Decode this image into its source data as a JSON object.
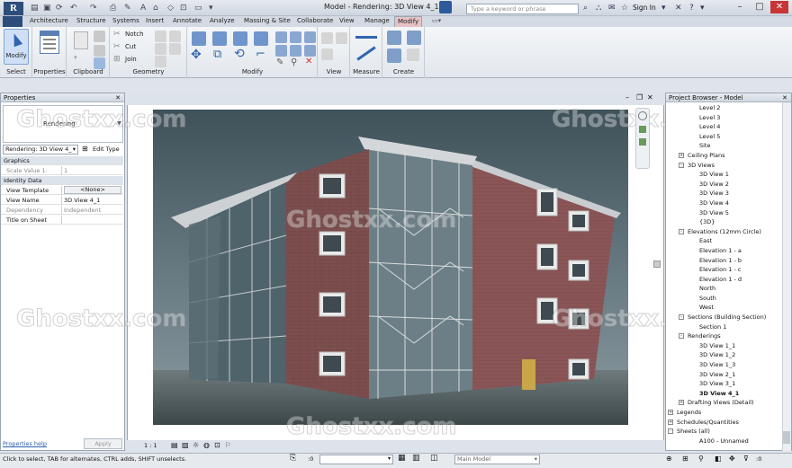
{
  "app": {
    "logo": "R",
    "title": "Model - Rendering: 3D View 4_1",
    "search_placeholder": "Type a keyword or phrase",
    "sign_in": "Sign In"
  },
  "tabs": [
    "Architecture",
    "Structure",
    "Systems",
    "Insert",
    "Annotate",
    "Analyze",
    "Massing & Site",
    "Collaborate",
    "View",
    "Manage",
    "Modify"
  ],
  "active_tab": "Modify",
  "ribbon": {
    "select": {
      "modify": "Modify",
      "label": "Select"
    },
    "properties": "Properties",
    "clipboard": {
      "label": "Clipboard"
    },
    "geometry": {
      "notch": "Notch",
      "cut": "Cut",
      "join": "Join",
      "label": "Geometry"
    },
    "modify_label": "Modify",
    "view_label": "View",
    "measure_label": "Measure",
    "create_label": "Create"
  },
  "properties": {
    "title": "Properties",
    "type_name": "Rendering",
    "view_selector": "Rendering: 3D View 4_",
    "edit_type": "Edit Type",
    "rows": [
      {
        "cat": "Graphics"
      },
      {
        "k": "Scale Value   1:",
        "v": "1",
        "dim": true
      },
      {
        "cat": "Identity Data"
      },
      {
        "k": "View Template",
        "v": "<None>",
        "button": true
      },
      {
        "k": "View Name",
        "v": "3D View 4_1"
      },
      {
        "k": "Dependency",
        "v": "Independent",
        "dim": true
      },
      {
        "k": "Title on Sheet",
        "v": ""
      }
    ],
    "help": "Properties help",
    "apply": "Apply"
  },
  "browser": {
    "title": "Project Browser - Model",
    "items": [
      {
        "t": "Level 2",
        "d": 3
      },
      {
        "t": "Level 3",
        "d": 3
      },
      {
        "t": "Level 4",
        "d": 3
      },
      {
        "t": "Level 5",
        "d": 3
      },
      {
        "t": "Site",
        "d": 3
      },
      {
        "t": "Ceiling Plans",
        "d": 2,
        "e": "+"
      },
      {
        "t": "3D Views",
        "d": 2,
        "e": "-"
      },
      {
        "t": "3D View 1",
        "d": 3
      },
      {
        "t": "3D View 2",
        "d": 3
      },
      {
        "t": "3D View 3",
        "d": 3
      },
      {
        "t": "3D View 4",
        "d": 3
      },
      {
        "t": "3D View 5",
        "d": 3
      },
      {
        "t": "{3D}",
        "d": 3
      },
      {
        "t": "Elevations (12mm Circle)",
        "d": 2,
        "e": "-"
      },
      {
        "t": "East",
        "d": 3
      },
      {
        "t": "Elevation 1 - a",
        "d": 3
      },
      {
        "t": "Elevation 1 - b",
        "d": 3
      },
      {
        "t": "Elevation 1 - c",
        "d": 3
      },
      {
        "t": "Elevation 1 - d",
        "d": 3
      },
      {
        "t": "North",
        "d": 3
      },
      {
        "t": "South",
        "d": 3
      },
      {
        "t": "West",
        "d": 3
      },
      {
        "t": "Sections (Building Section)",
        "d": 2,
        "e": "-"
      },
      {
        "t": "Section 1",
        "d": 3
      },
      {
        "t": "Renderings",
        "d": 2,
        "e": "-"
      },
      {
        "t": "3D View 1_1",
        "d": 3
      },
      {
        "t": "3D View 1_2",
        "d": 3
      },
      {
        "t": "3D View 1_3",
        "d": 3
      },
      {
        "t": "3D View 2_1",
        "d": 3
      },
      {
        "t": "3D View 3_1",
        "d": 3
      },
      {
        "t": "3D View 4_1",
        "d": 3,
        "bold": true
      },
      {
        "t": "Drafting Views (Detail)",
        "d": 2,
        "e": "+"
      },
      {
        "t": "Legends",
        "d": 1,
        "e": "+"
      },
      {
        "t": "Schedules/Quantities",
        "d": 1,
        "e": "+"
      },
      {
        "t": "Sheets (all)",
        "d": 1,
        "e": "-"
      },
      {
        "t": "A100 - Unnamed",
        "d": 3
      }
    ]
  },
  "view": {
    "scale": "1 : 1"
  },
  "status": {
    "hint": "Click to select, TAB for alternates, CTRL adds, SHIFT unselects.",
    "coord": ":0",
    "model": "Main Model"
  },
  "watermark": "Ghostxx.com"
}
